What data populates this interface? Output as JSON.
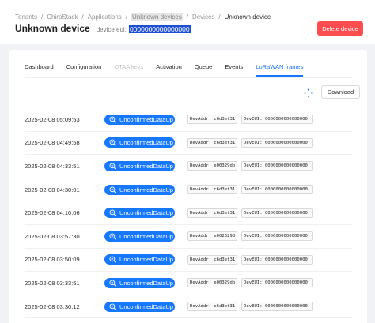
{
  "breadcrumb": [
    "Tenants",
    "ChirpStack",
    "Applications",
    "Unknown devices",
    "Devices",
    "Unknown device"
  ],
  "title": "Unknown device",
  "subtitle_label": "device eui:",
  "device_eui": "0000000000000000",
  "delete_label": "Delete device",
  "tabs": [
    {
      "label": "Dashboard",
      "state": "normal"
    },
    {
      "label": "Configuration",
      "state": "normal"
    },
    {
      "label": "OTAA keys",
      "state": "disabled"
    },
    {
      "label": "Activation",
      "state": "normal"
    },
    {
      "label": "Queue",
      "state": "normal"
    },
    {
      "label": "Events",
      "state": "normal"
    },
    {
      "label": "LoRaWAN frames",
      "state": "active"
    }
  ],
  "download_label": "Download",
  "frames": [
    {
      "time": "2025-02-08 05:09:53",
      "type": "UnconfirmedDataUp",
      "dev_addr": "DevAddr: c6d3ef31",
      "dev_eui": "DevEUI: 0000000000000000"
    },
    {
      "time": "2025-02-08 04:49:58",
      "type": "UnconfirmedDataUp",
      "dev_addr": "DevAddr: c6d3ef31",
      "dev_eui": "DevEUI: 0000000000000000"
    },
    {
      "time": "2025-02-08 04:33:51",
      "type": "UnconfirmedDataUp",
      "dev_addr": "DevAddr: e00329db",
      "dev_eui": "DevEUI: 0000000000000000"
    },
    {
      "time": "2025-02-08 04:30:01",
      "type": "UnconfirmedDataUp",
      "dev_addr": "DevAddr: c6d3ef31",
      "dev_eui": "DevEUI: 0000000000000000"
    },
    {
      "time": "2025-02-08 04:10:06",
      "type": "UnconfirmedDataUp",
      "dev_addr": "DevAddr: c6d3ef31",
      "dev_eui": "DevEUI: 0000000000000000"
    },
    {
      "time": "2025-02-08 03:57:30",
      "type": "UnconfirmedDataUp",
      "dev_addr": "DevAddr: e0026298",
      "dev_eui": "DevEUI: 0000000000000000"
    },
    {
      "time": "2025-02-08 03:50:09",
      "type": "UnconfirmedDataUp",
      "dev_addr": "DevAddr: c6d3ef31",
      "dev_eui": "DevEUI: 0000000000000000"
    },
    {
      "time": "2025-02-08 03:33:51",
      "type": "UnconfirmedDataUp",
      "dev_addr": "DevAddr: e00329db",
      "dev_eui": "DevEUI: 0000000000000000"
    },
    {
      "time": "2025-02-08 03:30:12",
      "type": "UnconfirmedDataUp",
      "dev_addr": "DevAddr: c6d3ef31",
      "dev_eui": "DevEUI: 0000000000000000"
    }
  ],
  "icons": {
    "frame_type": "zoom-in-icon",
    "loading": "spinner-icon"
  },
  "colors": {
    "primary": "#1677ff",
    "danger": "#ff4d4f",
    "selection": "#1d4fd6"
  }
}
